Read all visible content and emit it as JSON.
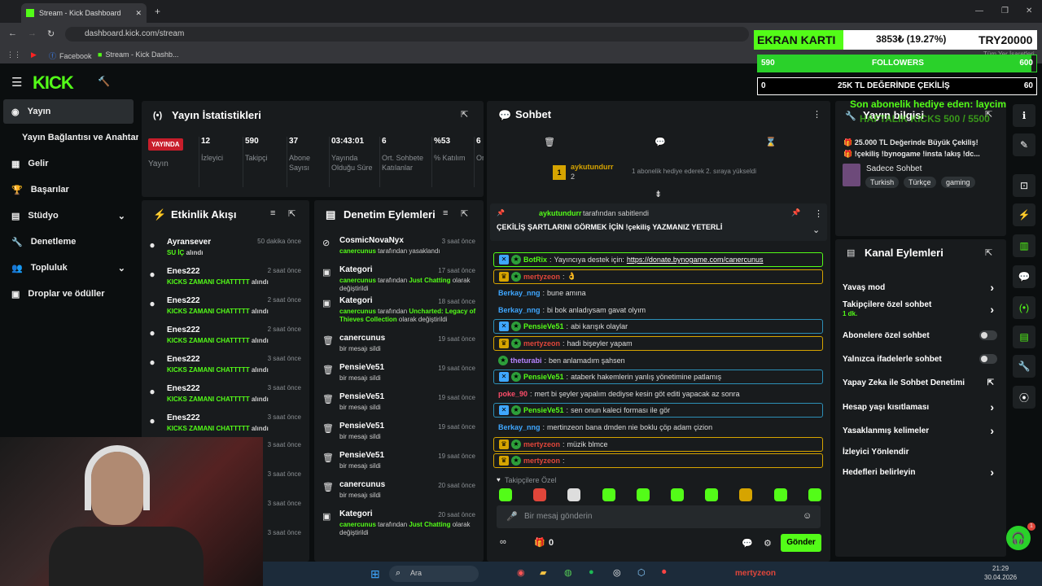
{
  "browser": {
    "tab_title": "Stream - Kick Dashboard",
    "url": "dashboard.kick.com/stream",
    "bookmarks": [
      "Facebook",
      "Stream - Kick Dashb..."
    ],
    "other_bookmarks": "Tüm Yer İşaretleri"
  },
  "overlay": {
    "title": "EKRAN KARTI",
    "price": "3853₺ (19.27%)",
    "goal": "TRY20000",
    "followers_current": "590",
    "followers_label": "FOLLOWERS",
    "followers_goal": "600",
    "giveaway_current": "0",
    "giveaway_label": "25K TL DEĞERİNDE ÇEKİLİŞ",
    "giveaway_goal": "60",
    "followers_progress": 0.983
  },
  "sidebar": {
    "items": [
      {
        "label": "Yayın",
        "icon": "broadcast-icon"
      },
      {
        "label": "Yayın Bağlantısı ve Anahtarı"
      },
      {
        "label": "Gelir"
      },
      {
        "label": "Başarılar"
      },
      {
        "label": "Stüdyo"
      },
      {
        "label": "Denetleme"
      },
      {
        "label": "Topluluk"
      },
      {
        "label": "Droplar ve ödüller"
      }
    ]
  },
  "stats": {
    "title": "Yayın İstatistikleri",
    "live": "YAYINDA",
    "live_label": "Yayın",
    "cells": [
      {
        "value": "12",
        "label": "İzleyici"
      },
      {
        "value": "590",
        "label": "Takipçi"
      },
      {
        "value": "37",
        "label": "Abone Sayısı"
      },
      {
        "value": "03:43:01",
        "label": "Yayında Olduğu Süre"
      },
      {
        "value": "6",
        "label": "Ort. Sohbete Katılanlar"
      },
      {
        "value": "%53",
        "label": "% Katılım"
      },
      {
        "value": "6",
        "label": "Or Sc Ka"
      }
    ]
  },
  "activity": {
    "title": "Etkinlik Akışı",
    "items": [
      {
        "name": "Ayransever",
        "sub": "SU İÇ",
        "sub2": "alındı",
        "time": "50 dakika önce"
      },
      {
        "name": "Enes222",
        "sub": "KICKS ZAMANI CHATTTTT",
        "sub2": "alındı",
        "time": "2 saat önce"
      },
      {
        "name": "Enes222",
        "sub": "KICKS ZAMANI CHATTTTT",
        "sub2": "alındı",
        "time": "2 saat önce"
      },
      {
        "name": "Enes222",
        "sub": "KICKS ZAMANI CHATTTTT",
        "sub2": "alındı",
        "time": "2 saat önce"
      },
      {
        "name": "Enes222",
        "sub": "KICKS ZAMANI CHATTTTT",
        "sub2": "alındı",
        "time": "3 saat önce"
      },
      {
        "name": "Enes222",
        "sub": "KICKS ZAMANI CHATTTTT",
        "sub2": "alındı",
        "time": "3 saat önce"
      },
      {
        "name": "Enes222",
        "sub": "KICKS ZAMANI CHATTTTT",
        "sub2": "alındı",
        "time": "3 saat önce"
      }
    ],
    "extra_times": [
      "3 saat önce",
      "3 saat önce",
      "3 saat önce",
      "3 saat önce"
    ]
  },
  "moderation": {
    "title": "Denetim Eylemleri",
    "items": [
      {
        "name": "CosmicNovaNyx",
        "line1": "canercunus",
        "line2": "tarafından yasaklandı",
        "time": "3 saat önce"
      },
      {
        "name": "Kategori",
        "line1": "canercunus",
        "line2": "tarafından",
        "line3": "Just Chatting",
        "line4": "olarak değiştirildi",
        "time": "17 saat önce"
      },
      {
        "name": "Kategori",
        "line1": "canercunus",
        "line2": "tarafından",
        "line3": "Uncharted: Legacy of Thieves Collection",
        "line4": "olarak değiştirildi",
        "time": "18 saat önce"
      },
      {
        "name": "canercunus",
        "line1": "bir mesajı sildi",
        "time": "19 saat önce"
      },
      {
        "name": "PensieVe51",
        "line1": "bir mesajı sildi",
        "time": "19 saat önce"
      },
      {
        "name": "PensieVe51",
        "line1": "bir mesajı sildi",
        "time": "19 saat önce"
      },
      {
        "name": "PensieVe51",
        "line1": "bir mesajı sildi",
        "time": "19 saat önce"
      },
      {
        "name": "PensieVe51",
        "line1": "bir mesajı sildi",
        "time": "19 saat önce"
      },
      {
        "name": "canercunus",
        "line1": "bir mesajı sildi",
        "time": "20 saat önce"
      },
      {
        "name": "Kategori",
        "line1": "canercunus",
        "line2": "tarafından",
        "line3": "Just Chatting",
        "line4": "olarak değiştirildi",
        "time": "20 saat önce"
      }
    ]
  },
  "chat": {
    "title": "Sohbet",
    "sub_user": "aykutundurr",
    "sub_count": "2",
    "sub_text": "1 abonelik hediye ederek 2. sıraya yükseldi",
    "pinned_by": "aykutundurr",
    "pinned_suffix": "tarafından sabitlendi",
    "pinned_msg": "ÇEKİLİŞ ŞARTLARINI GÖRMEK İÇİN !çekiliş YAZMANIZ YETERLİ",
    "messages": [
      {
        "user": "BotRix",
        "text": "Yayıncıya destek için:",
        "link": "https://donate.bynogame.com/canercunus",
        "hl": "green",
        "ucolor": "#53fc18"
      },
      {
        "user": "mertyzeon",
        "text": "👌",
        "hl": "gold",
        "ucolor": "#e0463a"
      },
      {
        "user": "Berkay_nng",
        "text": "bune amına",
        "hl": "",
        "ucolor": "#3fa7ff"
      },
      {
        "user": "Berkay_nng",
        "text": "bi bok anladıysam gavat olyım",
        "hl": "",
        "ucolor": "#3fa7ff"
      },
      {
        "user": "PensieVe51",
        "text": "abi karışık olaylar",
        "hl": "blue",
        "ucolor": "#53fc18"
      },
      {
        "user": "mertyzeon",
        "text": "hadi bişeyler yapam",
        "hl": "gold",
        "ucolor": "#e0463a"
      },
      {
        "user": "theturabi",
        "text": "ben anlamadım şahsen",
        "hl": "",
        "ucolor": "#b784ff"
      },
      {
        "user": "PensieVe51",
        "text": "ataberk hakemlerin yanlış yönetimine patlamış",
        "hl": "blue",
        "ucolor": "#53fc18"
      },
      {
        "user": "poke_90",
        "text": "mert bi şeyler yapalım dediyse kesin göt editi yapacak az sonra",
        "hl": "",
        "ucolor": "#ff4d6a"
      },
      {
        "user": "PensieVe51",
        "text": "sen onun kaleci forması ile gör",
        "hl": "blue",
        "ucolor": "#53fc18"
      },
      {
        "user": "Berkay_nng",
        "text": "mertinzeon bana dmden nie boklu çöp adam çizion",
        "hl": "",
        "ucolor": "#3fa7ff"
      },
      {
        "user": "mertyzeon",
        "text": "müzik blmce",
        "hl": "gold",
        "ucolor": "#e0463a"
      },
      {
        "user": "mertyzeon",
        "text": "",
        "hl": "gold",
        "ucolor": "#e0463a"
      }
    ],
    "followers_only": "Takipçilere Özel",
    "input_placeholder": "Bir mesaj gönderin",
    "points": "0",
    "send": "Gönder"
  },
  "stream_info": {
    "title": "Yayın bilgisi",
    "overlay_text": "Son abonelik hediye eden: laycim",
    "overlay_text2": "HAFTALIK KICKS 500 / 5500",
    "line1": "🎁 25.000 TL Değerinde Büyük Çekiliş!",
    "line2": "🎁 !çekiliş !bynogame !insta !akış !dc...",
    "category": "Sadece Sohbet",
    "tags": [
      "Turkish",
      "Türkçe",
      "gaming"
    ]
  },
  "channel_actions": {
    "title": "Kanal Eylemleri",
    "items": [
      {
        "label": "Yavaş mod",
        "type": "chevron"
      },
      {
        "label": "Takipçilere özel sohbet",
        "sub": "1 dk.",
        "type": "chevron"
      },
      {
        "label": "Abonelere özel sohbet",
        "type": "toggle"
      },
      {
        "label": "Yalnızca ifadelerle sohbet",
        "type": "toggle"
      },
      {
        "label": "Yapay Zeka ile Sohbet Denetimi",
        "type": "external"
      },
      {
        "label": "Hesap yaşı kısıtlaması",
        "type": "chevron"
      },
      {
        "label": "Yasaklanmış kelimeler",
        "type": "chevron"
      },
      {
        "label": "İzleyici Yönlendir",
        "type": "none"
      },
      {
        "label": "Hedefleri belirleyin",
        "type": "chevron"
      }
    ]
  },
  "taskbar": {
    "search": "Ara",
    "time": "21:29",
    "date": "30.04.2026",
    "notif_user": "mertyzeon"
  },
  "colors": {
    "kick_green": "#53fc18",
    "panel": "#181b1d",
    "bg": "#0b0e0f"
  }
}
